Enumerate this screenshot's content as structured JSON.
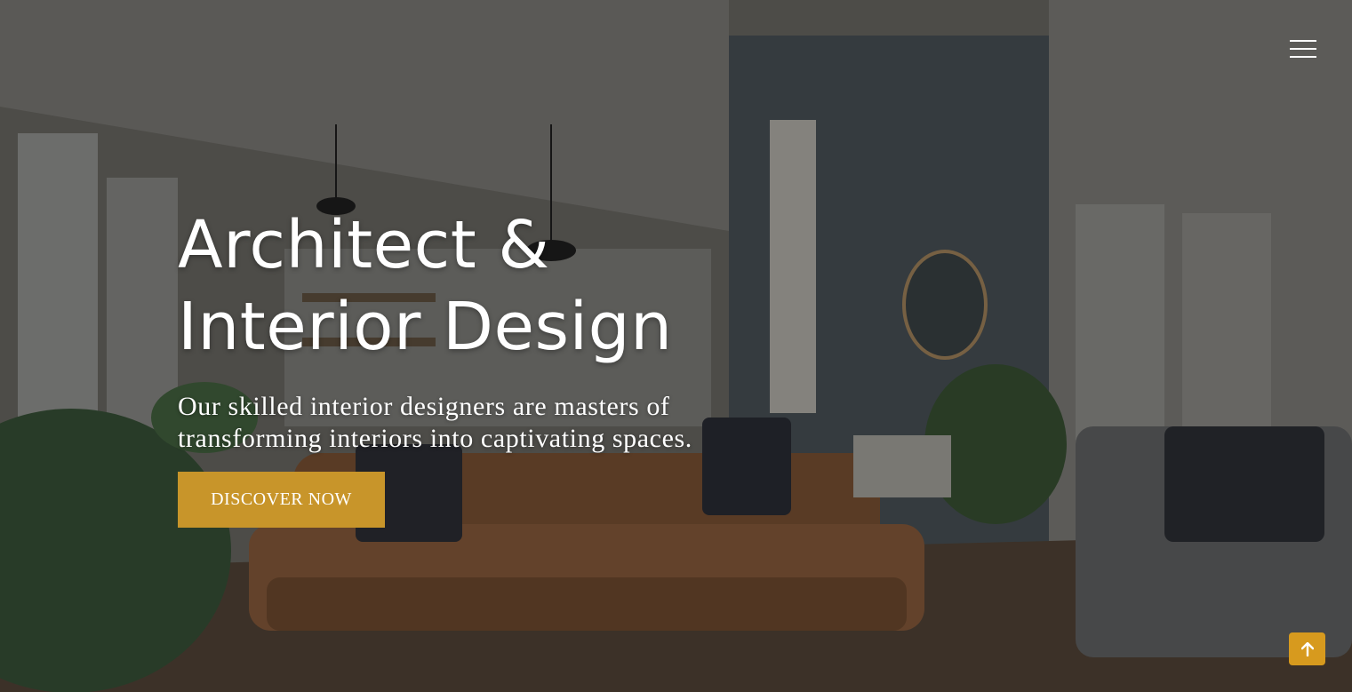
{
  "hero": {
    "headline_line1": "Architect &",
    "headline_line2": "Interior Design",
    "subtitle": "Our skilled interior designers are masters of transforming interiors into captivating spaces.",
    "cta_label": "DISCOVER NOW",
    "background_image": "living-room-photo"
  },
  "nav": {
    "menu_icon": "hamburger-icon"
  },
  "back_to_top": {
    "icon": "arrow-up-icon"
  },
  "colors": {
    "accent": "#c8952a",
    "back_to_top": "#d79a1e",
    "text": "#ffffff"
  }
}
